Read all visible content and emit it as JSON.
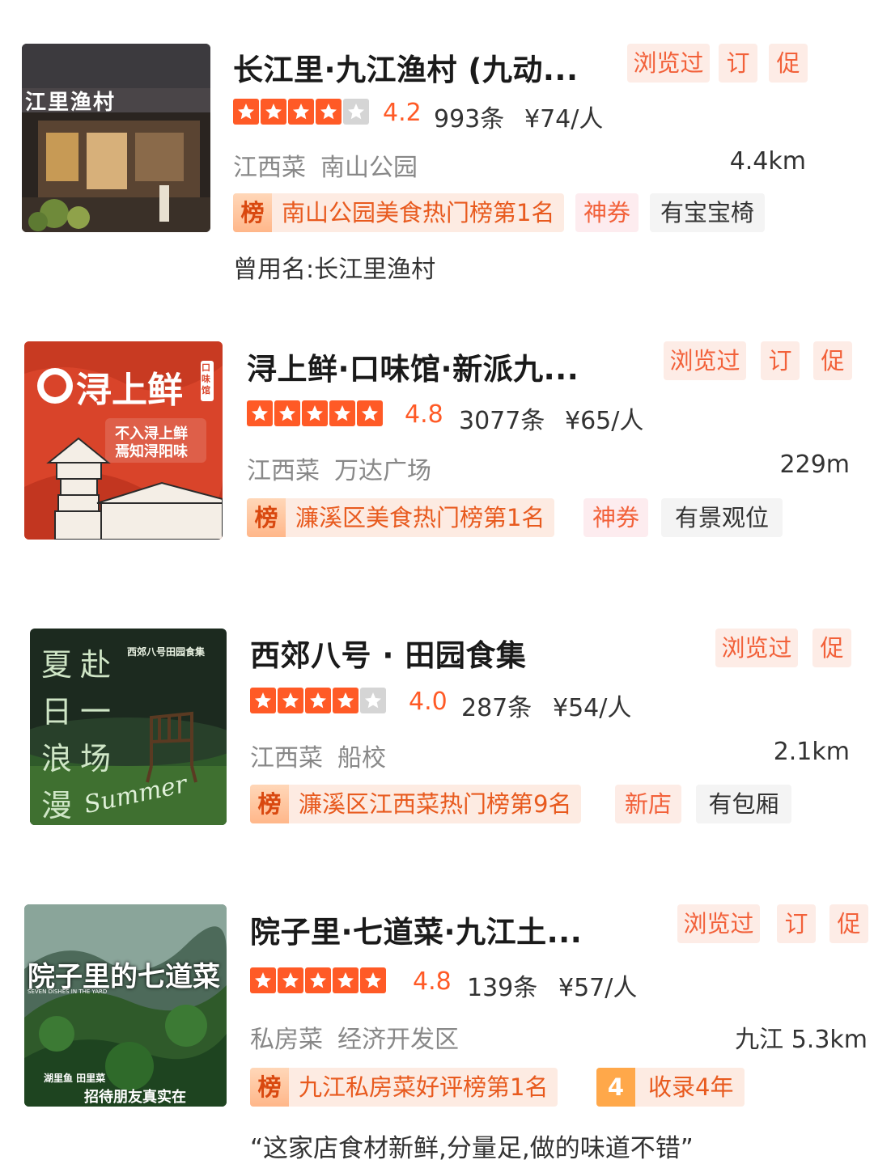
{
  "restaurants": [
    {
      "name": "长江里·九江渔村 (九动...",
      "tags": [
        "浏览过",
        "订",
        "促"
      ],
      "rating": "4.2",
      "stars_filled": 4.2,
      "reviews": "993条",
      "price": "¥74/人",
      "cuisine": "江西菜",
      "area": "南山公园",
      "distance": "4.4km",
      "rank_icon": "榜",
      "rank": "南山公园美食热门榜第1名",
      "coupon": "神券",
      "feature": "有宝宝椅",
      "extra": "曾用名:长江里渔村",
      "image_text": "江里渔村"
    },
    {
      "name": "浔上鲜·口味馆·新派九...",
      "tags": [
        "浏览过",
        "订",
        "促"
      ],
      "rating": "4.8",
      "stars_filled": 4.8,
      "reviews": "3077条",
      "price": "¥65/人",
      "cuisine": "江西菜",
      "area": "万达广场",
      "distance": "229m",
      "rank_icon": "榜",
      "rank": "濂溪区美食热门榜第1名",
      "coupon": "神券",
      "feature": "有景观位",
      "image_text": "浔上鲜",
      "image_sub1": "口味馆",
      "image_sub2": "不入浔上鲜",
      "image_sub3": "焉知浔阳味"
    },
    {
      "name": "西郊八号 · 田园食集",
      "tags": [
        "浏览过",
        "促"
      ],
      "rating": "4.0",
      "stars_filled": 4.0,
      "reviews": "287条",
      "price": "¥54/人",
      "cuisine": "江西菜",
      "area": "船校",
      "distance": "2.1km",
      "rank_icon": "榜",
      "rank": "濂溪区江西菜热门榜第9名",
      "coupon": "新店",
      "feature": "有包厢",
      "image_col1": "夏日浪漫",
      "image_col2": "赴一场",
      "image_brand": "西郊八号田园食集",
      "image_script": "Summer"
    },
    {
      "name": "院子里·七道菜·九江土...",
      "tags": [
        "浏览过",
        "订",
        "促"
      ],
      "rating": "4.8",
      "stars_filled": 4.8,
      "reviews": "139条",
      "price": "¥57/人",
      "cuisine": "私房菜",
      "area": "经济开发区",
      "distance": "九江 5.3km",
      "rank_icon": "榜",
      "rank": "九江私房菜好评榜第1名",
      "years_icon": "4",
      "years": "收录4年",
      "extra": "“这家店食材新鲜,分量足,做的味道不错”",
      "image_text": "院子里的七道菜",
      "image_en": "SEVEN DISHES IN THE YARD",
      "image_sub": "湖里鱼 田里菜",
      "image_sub2": "招待朋友真实在"
    }
  ],
  "colors": {
    "accent": "#ff5a26",
    "tag_bg": "#fdece6",
    "muted": "#888888"
  }
}
